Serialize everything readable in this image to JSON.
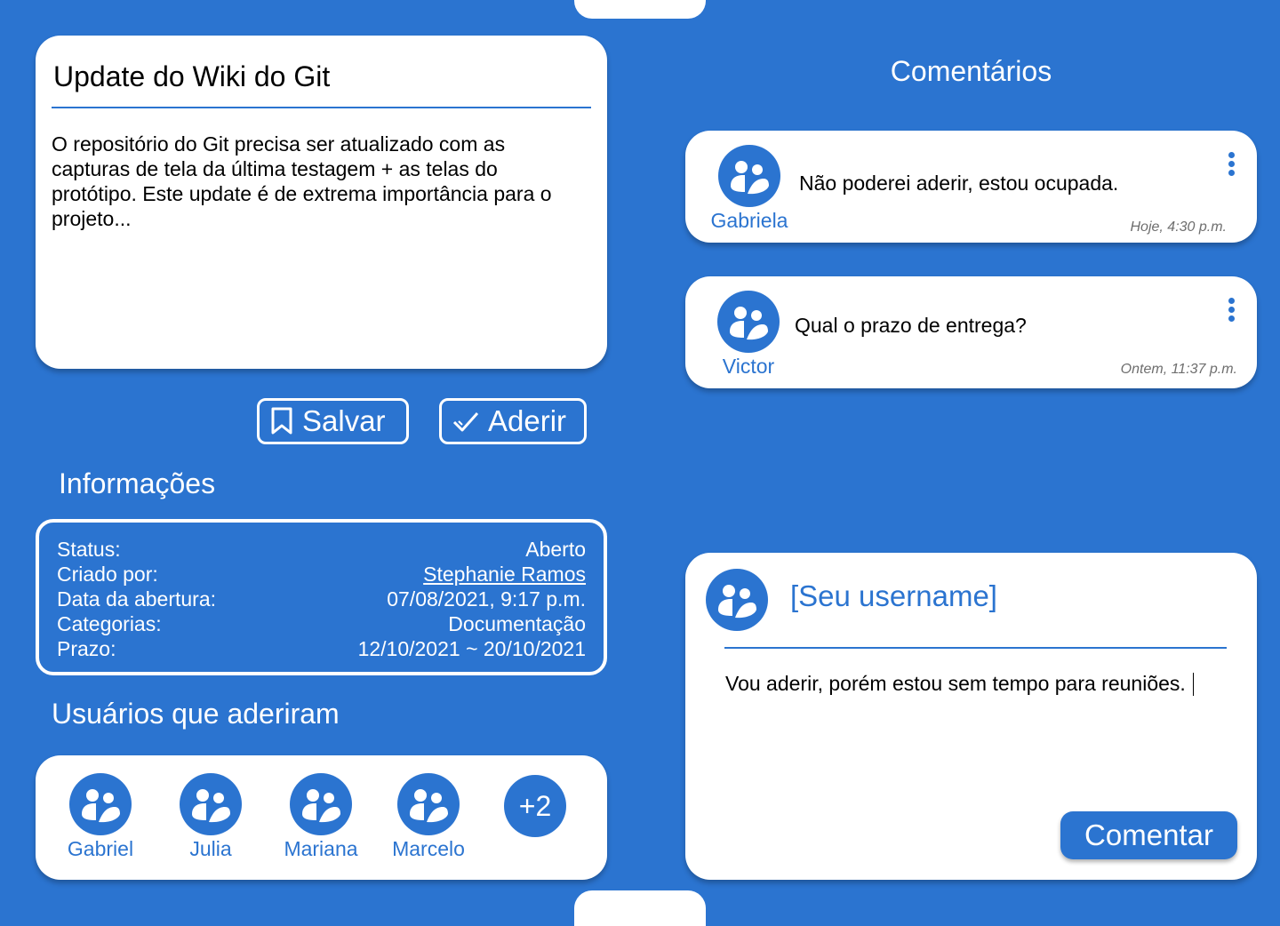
{
  "task": {
    "title": "Update do Wiki do Git",
    "description": "O repositório do Git precisa ser atualizado com as capturas de tela da última testagem + as telas do protótipo. Este update é de extrema importância para o projeto..."
  },
  "actions": {
    "save_label": "Salvar",
    "join_label": "Aderir",
    "save_icon": "bookmark-icon",
    "join_icon": "check-icon"
  },
  "info": {
    "title": "Informações",
    "rows": [
      {
        "label": "Status:",
        "value": "Aberto"
      },
      {
        "label": "Criado por:",
        "value": "Stephanie Ramos"
      },
      {
        "label": "Data da abertura:",
        "value": "07/08/2021,  9:17 p.m."
      },
      {
        "label": "Categorias:",
        "value": "Documentação"
      },
      {
        "label": "Prazo:",
        "value": "12/10/2021 ~ 20/10/2021"
      }
    ]
  },
  "members": {
    "title": "Usuários que aderiram",
    "users": [
      {
        "name": "Gabriel"
      },
      {
        "name": "Julia"
      },
      {
        "name": "Mariana"
      },
      {
        "name": "Marcelo"
      }
    ],
    "more": "+2"
  },
  "comments": {
    "title": "Comentários",
    "items": [
      {
        "author": "Gabriela",
        "text": "Não poderei aderir, estou ocupada.",
        "time": "Hoje, 4:30 p.m."
      },
      {
        "author": "Victor",
        "text": "Qual o prazo de entrega?",
        "time": "Ontem, 11:37 p.m."
      }
    ]
  },
  "new_comment": {
    "username": "[Seu username]",
    "text": "Vou aderir, porém estou sem tempo para reuniões.",
    "button": "Comentar"
  },
  "colors": {
    "primary": "#2b74d0",
    "card": "#ffffff",
    "timestamp": "#6e6e6e"
  }
}
